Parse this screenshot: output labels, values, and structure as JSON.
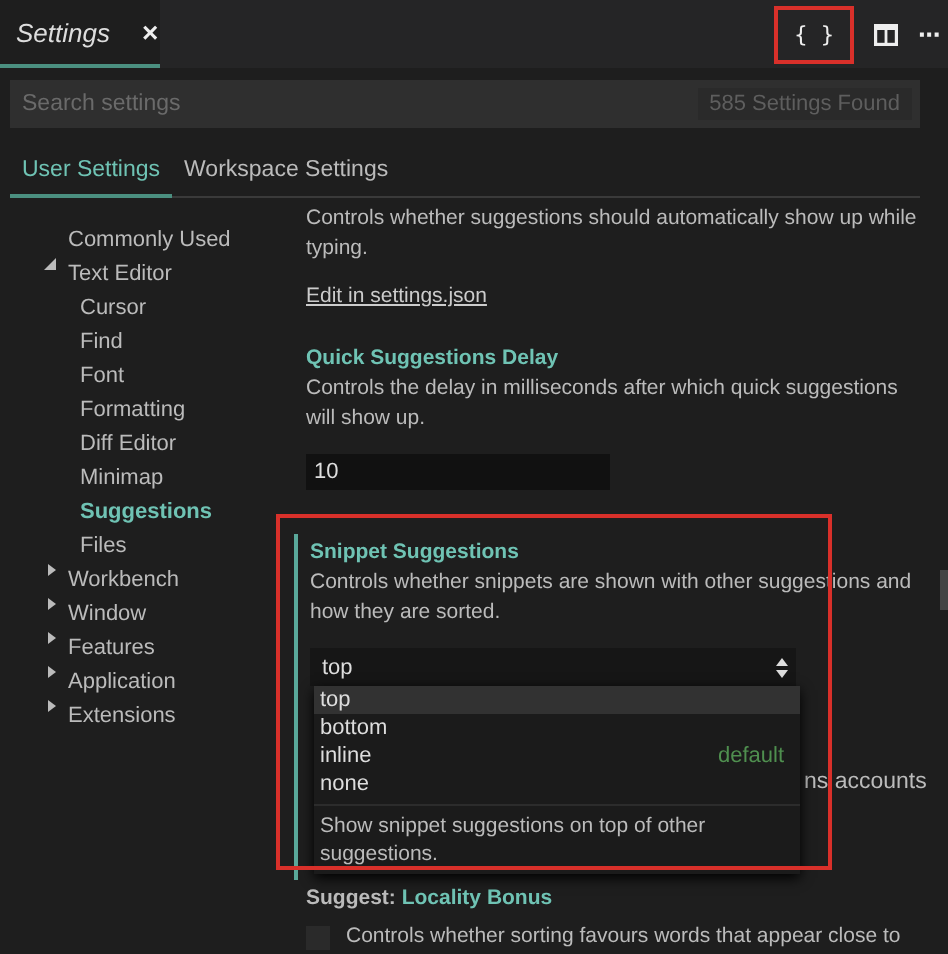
{
  "editor_tab": {
    "title": "Settings",
    "close": "×"
  },
  "toolbar": {
    "json_button": "{ }",
    "more": "···"
  },
  "search": {
    "placeholder": "Search settings",
    "result_count": "585 Settings Found"
  },
  "scope_tabs": [
    {
      "label": "User Settings",
      "selected": true
    },
    {
      "label": "Workspace Settings",
      "selected": false
    }
  ],
  "tree": [
    {
      "label": "Commonly Used",
      "selected": false
    },
    {
      "label": "Text Editor",
      "selected": false,
      "expanded": true,
      "children": [
        {
          "label": "Cursor",
          "selected": false
        },
        {
          "label": "Find",
          "selected": false
        },
        {
          "label": "Font",
          "selected": false
        },
        {
          "label": "Formatting",
          "selected": false
        },
        {
          "label": "Diff Editor",
          "selected": false
        },
        {
          "label": "Minimap",
          "selected": false
        },
        {
          "label": "Suggestions",
          "selected": true
        },
        {
          "label": "Files",
          "selected": false
        }
      ]
    },
    {
      "label": "Workbench",
      "selected": false,
      "expanded": false
    },
    {
      "label": "Window",
      "selected": false,
      "expanded": false
    },
    {
      "label": "Features",
      "selected": false,
      "expanded": false
    },
    {
      "label": "Application",
      "selected": false,
      "expanded": false
    },
    {
      "label": "Extensions",
      "selected": false,
      "expanded": false
    }
  ],
  "settings": {
    "previous": {
      "description": "Controls whether suggestions should automatically show up while typing.",
      "link": "Edit in settings.json"
    },
    "quick_suggestions_delay": {
      "title": "Quick Suggestions Delay",
      "description": "Controls the delay in milliseconds after which quick suggestions will show up.",
      "value": "10"
    },
    "snippet_suggestions": {
      "title": "Snippet Suggestions",
      "description": "Controls whether snippets are shown with other suggestions and how they are sorted.",
      "value": "top",
      "options": [
        {
          "label": "top",
          "selected": true
        },
        {
          "label": "bottom",
          "selected": false
        },
        {
          "label": "inline",
          "selected": false,
          "badge": "default"
        },
        {
          "label": "none",
          "selected": false
        }
      ],
      "option_description": "Show snippet suggestions on top of other suggestions."
    },
    "hidden_setting_text": "ns accounts",
    "locality_bonus": {
      "category": "Suggest:",
      "title": "Locality Bonus",
      "checked": false,
      "description": "Controls whether sorting favours words that appear close to"
    }
  }
}
